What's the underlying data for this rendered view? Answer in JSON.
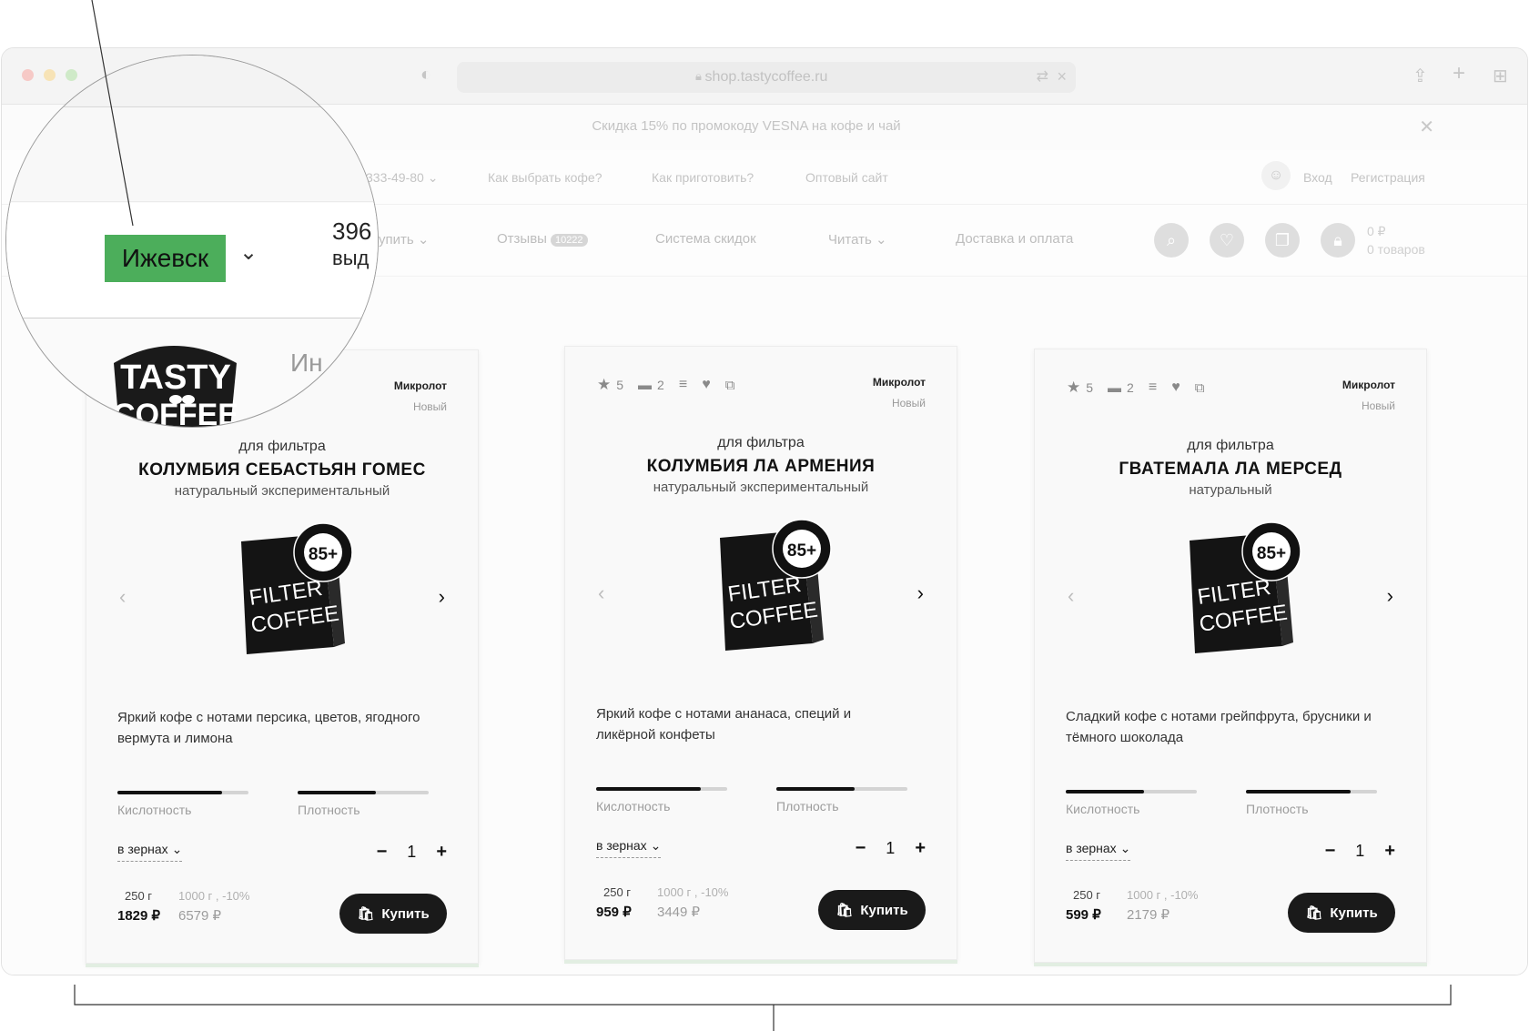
{
  "browser": {
    "url": "shop.tastycoffee.ru"
  },
  "promo": {
    "text": "Скидка 15% по промокоду VESNA на кофе и чай"
  },
  "topnav": {
    "phone": "333-49-80",
    "links": [
      "Как выбрать кофе?",
      "Как приготовить?",
      "Оптовый сайт"
    ],
    "login": "Вход",
    "register": "Регистрация"
  },
  "mainnav": {
    "items": [
      {
        "label": "упить"
      },
      {
        "label": "Отзывы",
        "badge": "10222"
      },
      {
        "label": "Система скидок"
      },
      {
        "label": "Читать"
      },
      {
        "label": "Доставка и оплата"
      }
    ],
    "cart_price": "0 ₽",
    "cart_count": "0 товаров"
  },
  "magnifier": {
    "city": "Ижевск",
    "phone_fragment": "396",
    "fragment_below": "выд",
    "logo_line1": "TASTY",
    "logo_line2": "COFFEE",
    "logo_fragment": "Ин"
  },
  "products": [
    {
      "rating": "5",
      "comments": "2",
      "lot": "Микролот",
      "lot_status": "Новый",
      "method": "для фильтра",
      "title": "КОЛУМБИЯ СЕБАСТЬЯН ГОМЕС",
      "kind": "натуральный экспериментальный",
      "description": "Яркий кофе с нотами персика, цветов, ягодного вермута и лимона",
      "acidity": 0.8,
      "density": 0.6,
      "acidity_label": "Кислотность",
      "density_label": "Плотность",
      "grind": "в зернах",
      "qty": "1",
      "weight1": "250 г",
      "weight2": "1000 г ,  -10%",
      "price1": "1829 ₽",
      "price2": "6579 ₽",
      "buy": "Купить"
    },
    {
      "rating": "5",
      "comments": "2",
      "lot": "Микролот",
      "lot_status": "Новый",
      "method": "для фильтра",
      "title": "КОЛУМБИЯ ЛА АРМЕНИЯ",
      "kind": "натуральный экспериментальный",
      "description": "Яркий кофе с нотами ананаса, специй и ликёрной конфеты",
      "acidity": 0.8,
      "density": 0.6,
      "acidity_label": "Кислотность",
      "density_label": "Плотность",
      "grind": "в зернах",
      "qty": "1",
      "weight1": "250 г",
      "weight2": "1000 г ,  -10%",
      "price1": "959 ₽",
      "price2": "3449 ₽",
      "buy": "Купить"
    },
    {
      "rating": "5",
      "comments": "2",
      "lot": "Микролот",
      "lot_status": "Новый",
      "method": "для фильтра",
      "title": "ГВАТЕМАЛА ЛА МЕРСЕД",
      "kind": "натуральный",
      "description": "Сладкий кофе с нотами грейпфрута, брусники и тёмного шоколада",
      "acidity": 0.6,
      "density": 0.8,
      "acidity_label": "Кислотность",
      "density_label": "Плотность",
      "grind": "в зернах",
      "qty": "1",
      "weight1": "250 г",
      "weight2": "1000 г ,  -10%",
      "price1": "599 ₽",
      "price2": "2179 ₽",
      "buy": "Купить"
    }
  ],
  "package": {
    "badge": "85+",
    "ring_text": "ОЦЕНКА Q-ГРЕЙДЕРА · LIMITED MICROLOT COFFEE",
    "line1": "FILTER",
    "line2": "COFFEE"
  }
}
